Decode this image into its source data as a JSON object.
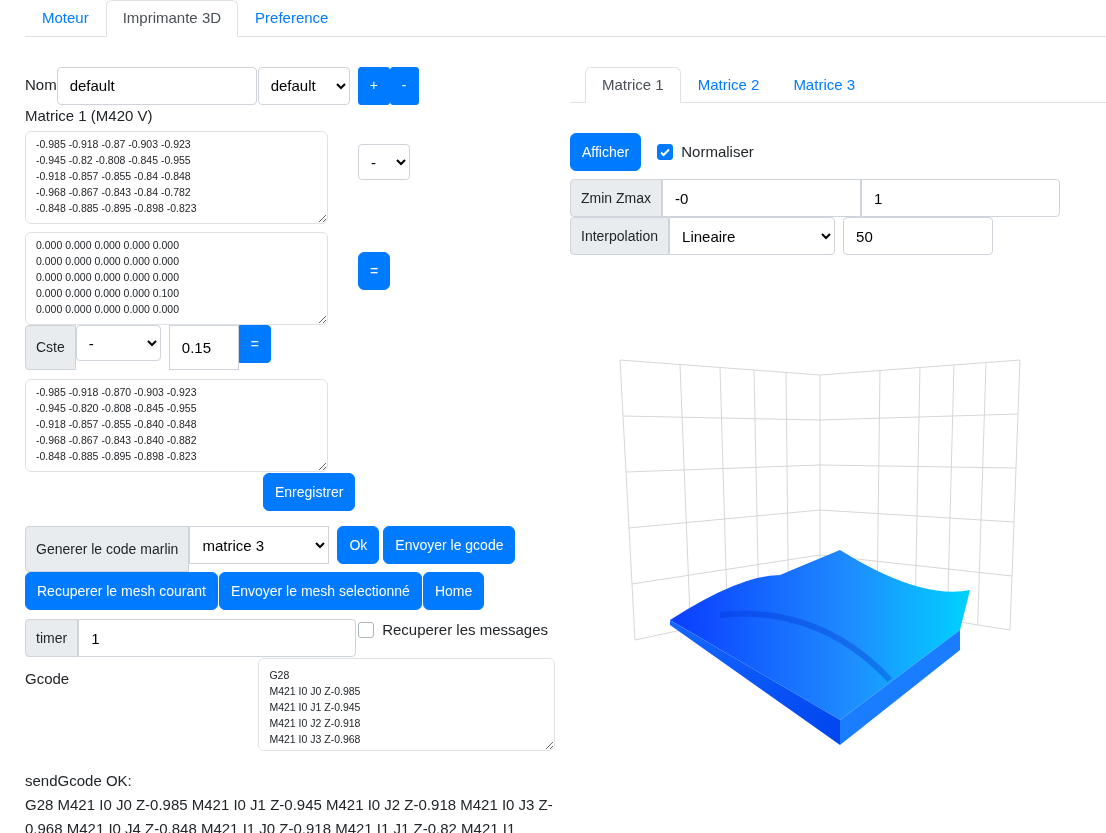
{
  "tabs": [
    {
      "label": "Moteur",
      "selected": false
    },
    {
      "label": "Imprimante 3D",
      "selected": true
    },
    {
      "label": "Preference",
      "selected": false
    }
  ],
  "profile": {
    "label": "Nom",
    "value": "default",
    "select": "default",
    "buttons": [
      "+",
      "-"
    ]
  },
  "matrix_title": "Matrice 1 (M420 V)",
  "matrix_a": [
    "-0.985 -0.918 -0.87 -0.903 -0.923",
    "-0.945 -0.82 -0.808 -0.845 -0.955",
    "-0.918 -0.857 -0.855 -0.84 -0.848",
    "-0.968 -0.867 -0.843 -0.84 -0.782",
    "-0.848 -0.885 -0.895 -0.898 -0.823"
  ],
  "operator": "-",
  "matrix_b": [
    "0.000 0.000 0.000 0.000 0.000",
    "0.000 0.000 0.000 0.000 0.000",
    "0.000 0.000 0.000 0.000 0.000",
    "0.000 0.000 0.000 0.000 0.100",
    "0.000 0.000 0.000 0.000 0.000"
  ],
  "equals_button": "=",
  "constant": {
    "label": "Cste",
    "select": "-",
    "value": "0.15",
    "button": "="
  },
  "result": [
    "-0.985 -0.918 -0.870 -0.903 -0.923",
    "-0.945 -0.820 -0.808 -0.845 -0.955",
    "-0.918 -0.857 -0.855 -0.840 -0.848",
    "-0.968 -0.867 -0.843 -0.840 -0.882",
    "-0.848 -0.885 -0.895 -0.898 -0.823"
  ],
  "save_button": "Enregistrer",
  "marlin": {
    "label": "Generer le code marlin",
    "select": "matrice 3",
    "buttons": [
      "Ok",
      "Envoyer le gcode"
    ]
  },
  "mesh_buttons": [
    "Recuperer le mesh courant",
    "Envoyer le mesh selectionné",
    "Home"
  ],
  "timer": {
    "label": "timer",
    "value": "1"
  },
  "messages_checkbox": {
    "label": "Recuperer les messages",
    "checked": false
  },
  "gcode": {
    "label": "Gcode",
    "lines": [
      "G28",
      "M421 I0 J0 Z-0.985",
      "M421 I0 J1 Z-0.945",
      "M421 I0 J2 Z-0.918",
      "M421 I0 J3 Z-0.968"
    ]
  },
  "response": {
    "title": "sendGcode OK:",
    "text": "G28 M421 I0 J0 Z-0.985 M421 I0 J1 Z-0.945 M421 I0 J2 Z-0.918 M421 I0 J3 Z-0.968 M421 I0 J4 Z-0.848 M421 I1 J0 Z-0.918 M421 I1 J1 Z-0.82 M421 I1"
  },
  "matrix_tabs": [
    {
      "label": "Matrice 1",
      "selected": true
    },
    {
      "label": "Matrice 2",
      "selected": false
    },
    {
      "label": "Matrice 3",
      "selected": false
    }
  ],
  "show_button": "Afficher",
  "normalize": {
    "label": "Normaliser",
    "checked": true
  },
  "z_range": {
    "label": "Zmin Zmax",
    "min": "-0",
    "max": "1"
  },
  "interpolation": {
    "label": "Interpolation",
    "select": "Lineaire",
    "value": "50"
  }
}
